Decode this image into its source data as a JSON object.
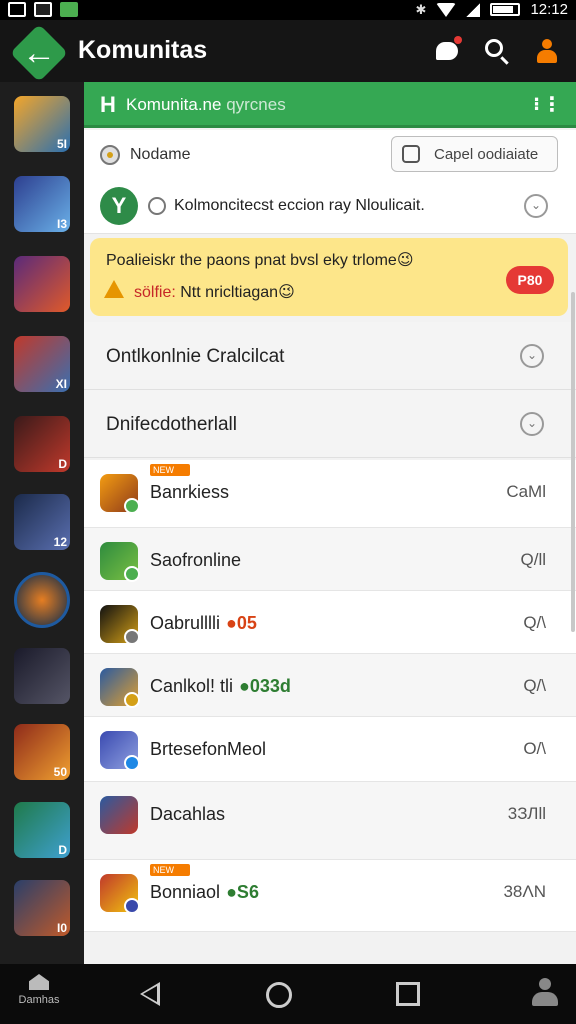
{
  "status_bar": {
    "time": "12:12"
  },
  "app_bar": {
    "title": "Komunitas"
  },
  "panel_header": {
    "title": "Komunita.ne",
    "subtitle": "qyrcnes"
  },
  "nickname_row": {
    "label": "Nodame",
    "button_label": "Capel oodiaiate"
  },
  "post_row": {
    "avatar_letter": "Y",
    "text": "Kolmoncitecst eccion ray Nloulicait."
  },
  "alert": {
    "line1": "Poalieiskr the paons  pnat bvsl eky trlome😉",
    "line2_warn": "sölfie:",
    "line2_rest": " Ntt nricltiagan😉",
    "badge": "P80"
  },
  "sections": [
    {
      "label": "Ontlkonlnie Cralcilcat"
    },
    {
      "label": "Dnifecdotherlall"
    }
  ],
  "games": [
    {
      "name": "Banrkiess",
      "extra": "",
      "meta": "CaMl",
      "tag": "NEW"
    },
    {
      "name": "Saofronline",
      "extra": "",
      "meta": "Q/ll",
      "tag": ""
    },
    {
      "name": "Oabrulllli",
      "extra": "●05",
      "meta": "Q/\\",
      "tag": ""
    },
    {
      "name": "Canlkol! tli",
      "extra": "●033d",
      "meta": "Q/\\",
      "tag": ""
    },
    {
      "name": "BrtesefonMeol",
      "extra": "",
      "meta": "O/\\",
      "tag": ""
    },
    {
      "name": "Dacahlas",
      "extra": "",
      "meta": "3ЗЛll",
      "tag": ""
    },
    {
      "name": "Bonniaol",
      "extra": "●S6",
      "meta": "38ΛN",
      "tag": "NEW"
    }
  ],
  "rail_items": [
    {
      "tag": "5I"
    },
    {
      "tag": "I3"
    },
    {
      "tag": ""
    },
    {
      "tag": "XI"
    },
    {
      "tag": "D"
    },
    {
      "tag": "12"
    },
    {
      "tag": ""
    },
    {
      "tag": ""
    },
    {
      "tag": "50"
    },
    {
      "tag": "D"
    },
    {
      "tag": "I0"
    }
  ],
  "bottom_nav": {
    "home_label": "Damhas"
  },
  "colors": {
    "brand_green": "#35a853",
    "alert_bg": "#fde68a",
    "badge_red": "#e53935"
  }
}
